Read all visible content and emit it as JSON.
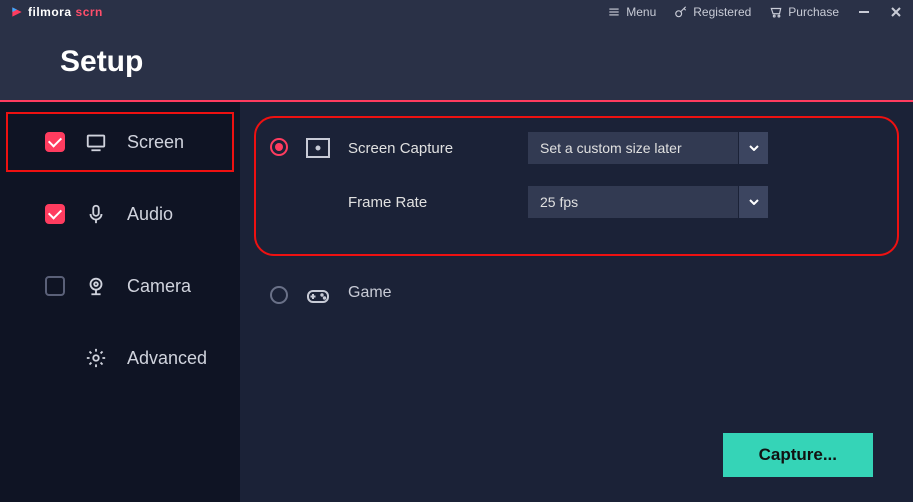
{
  "brand": {
    "part1": "filmora",
    "part2": " scrn"
  },
  "topbar": {
    "menu": "Menu",
    "registered": "Registered",
    "purchase": "Purchase"
  },
  "title": "Setup",
  "sidebar": {
    "items": [
      {
        "label": "Screen",
        "checked": true
      },
      {
        "label": "Audio",
        "checked": true
      },
      {
        "label": "Camera",
        "checked": false
      },
      {
        "label": "Advanced",
        "checked": null
      }
    ]
  },
  "content": {
    "screen": {
      "fields": {
        "capture_label": "Screen Capture",
        "capture_value": "Set a custom size later",
        "rate_label": "Frame Rate",
        "rate_value": "25 fps"
      }
    },
    "game": {
      "label": "Game"
    }
  },
  "capture_button": "Capture..."
}
